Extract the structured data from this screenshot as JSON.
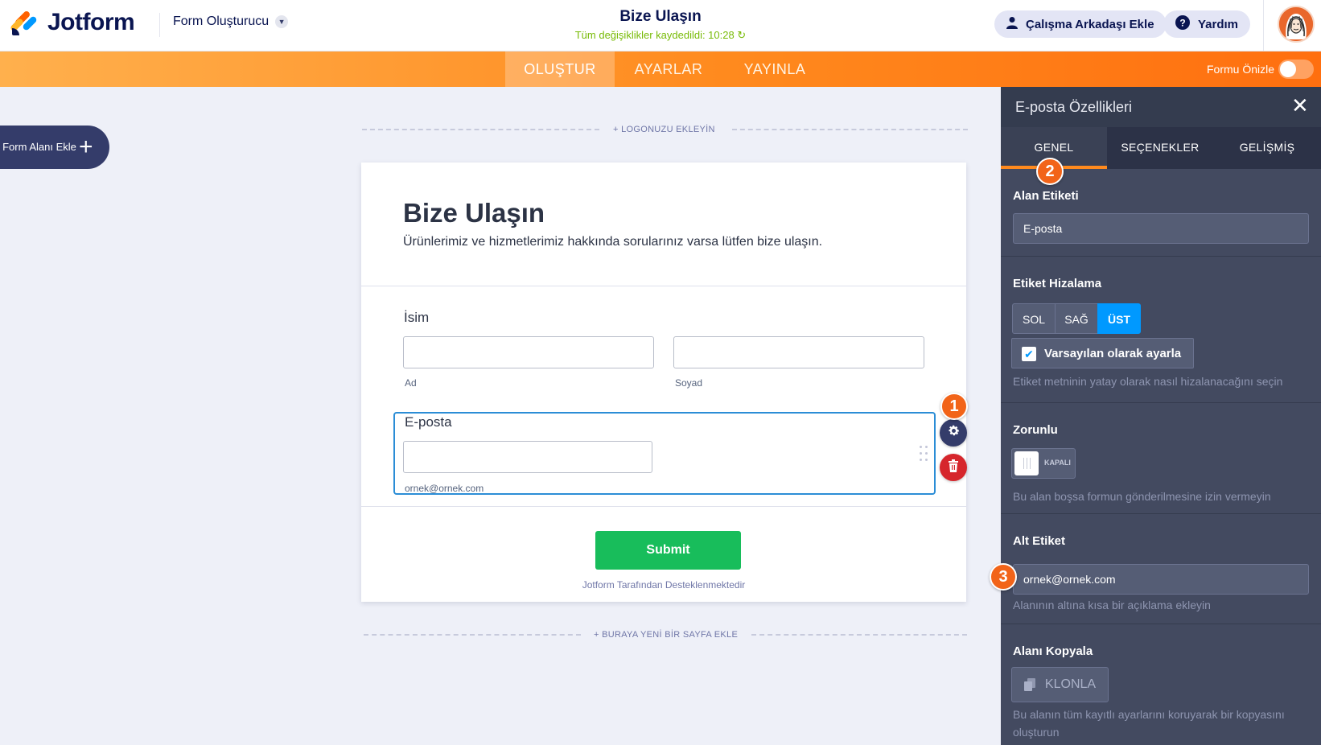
{
  "brand": {
    "name": "Jotform"
  },
  "topbar": {
    "builder_label": "Form Oluşturucu",
    "form_title": "Bize Ulaşın",
    "save_status": "Tüm değişiklikler kaydedildi: 10:28",
    "add_collaborator": "Çalışma Arkadaşı Ekle",
    "help": "Yardım"
  },
  "nav": {
    "tabs": [
      "OLUŞTUR",
      "AYARLAR",
      "YAYINLA"
    ],
    "active_tab": "OLUŞTUR",
    "preview_label": "Formu Önizle",
    "preview_enabled": false
  },
  "builder": {
    "add_field": "Form Alanı Ekle",
    "add_logo": "+ LOGONUZU EKLEYİN",
    "add_page": "+ BURAYA YENİ BİR SAYFA EKLE"
  },
  "form": {
    "heading": "Bize Ulaşın",
    "subheading": "Ürünlerimiz ve hizmetlerimiz hakkında sorularınız varsa lütfen bize ulaşın.",
    "name_label": "İsim",
    "first_sublabel": "Ad",
    "last_sublabel": "Soyad",
    "email_label": "E-posta",
    "email_sublabel": "ornek@ornek.com",
    "submit": "Submit",
    "powered_by": "Jotform Tarafından Desteklenmektedir"
  },
  "markers": [
    "1",
    "2",
    "3"
  ],
  "panel": {
    "title": "E-posta Özellikleri",
    "tabs": [
      "GENEL",
      "SEÇENEKLER",
      "GELİŞMİŞ"
    ],
    "active_tab": "GENEL",
    "field_label_title": "Alan Etiketi",
    "field_label_value": "E-posta",
    "align_title": "Etiket Hizalama",
    "align_options": [
      "SOL",
      "SAĞ",
      "ÜST"
    ],
    "align_selected": "ÜST",
    "default_checkbox": "Varsayılan olarak ayarla",
    "default_checked": true,
    "align_hint": "Etiket metninin yatay olarak nasıl hizalanacağını seçin",
    "required_title": "Zorunlu",
    "required_state": "KAPALI",
    "required_hint": "Bu alan boşsa formun gönderilmesine izin vermeyin",
    "sublabel_title": "Alt Etiket",
    "sublabel_value": "ornek@ornek.com",
    "sublabel_hint": "Alanının altına kısa bir açıklama ekleyin",
    "duplicate_title": "Alanı Kopyala",
    "clone_button": "KLONLA",
    "duplicate_hint": "Bu alanın tüm kayıtlı ayarlarını koruyarak bir kopyasını oluşturun"
  },
  "colors": {
    "brand_navy": "#0a1551",
    "orange": "#ff8a1e",
    "panel_bg": "#434a60",
    "submit_green": "#18bd5b",
    "selection_blue": "#2b8dd6",
    "active_blue": "#0099ff",
    "saved_green": "#78bb07"
  },
  "icons": [
    "jotform-logo",
    "chevron-down-icon",
    "user-icon",
    "help-icon",
    "user-avatar",
    "plus-icon",
    "gear-icon",
    "trash-icon",
    "drag-handle-icon",
    "close-icon",
    "checkmark-icon",
    "clone-icon",
    "refresh-icon"
  ]
}
